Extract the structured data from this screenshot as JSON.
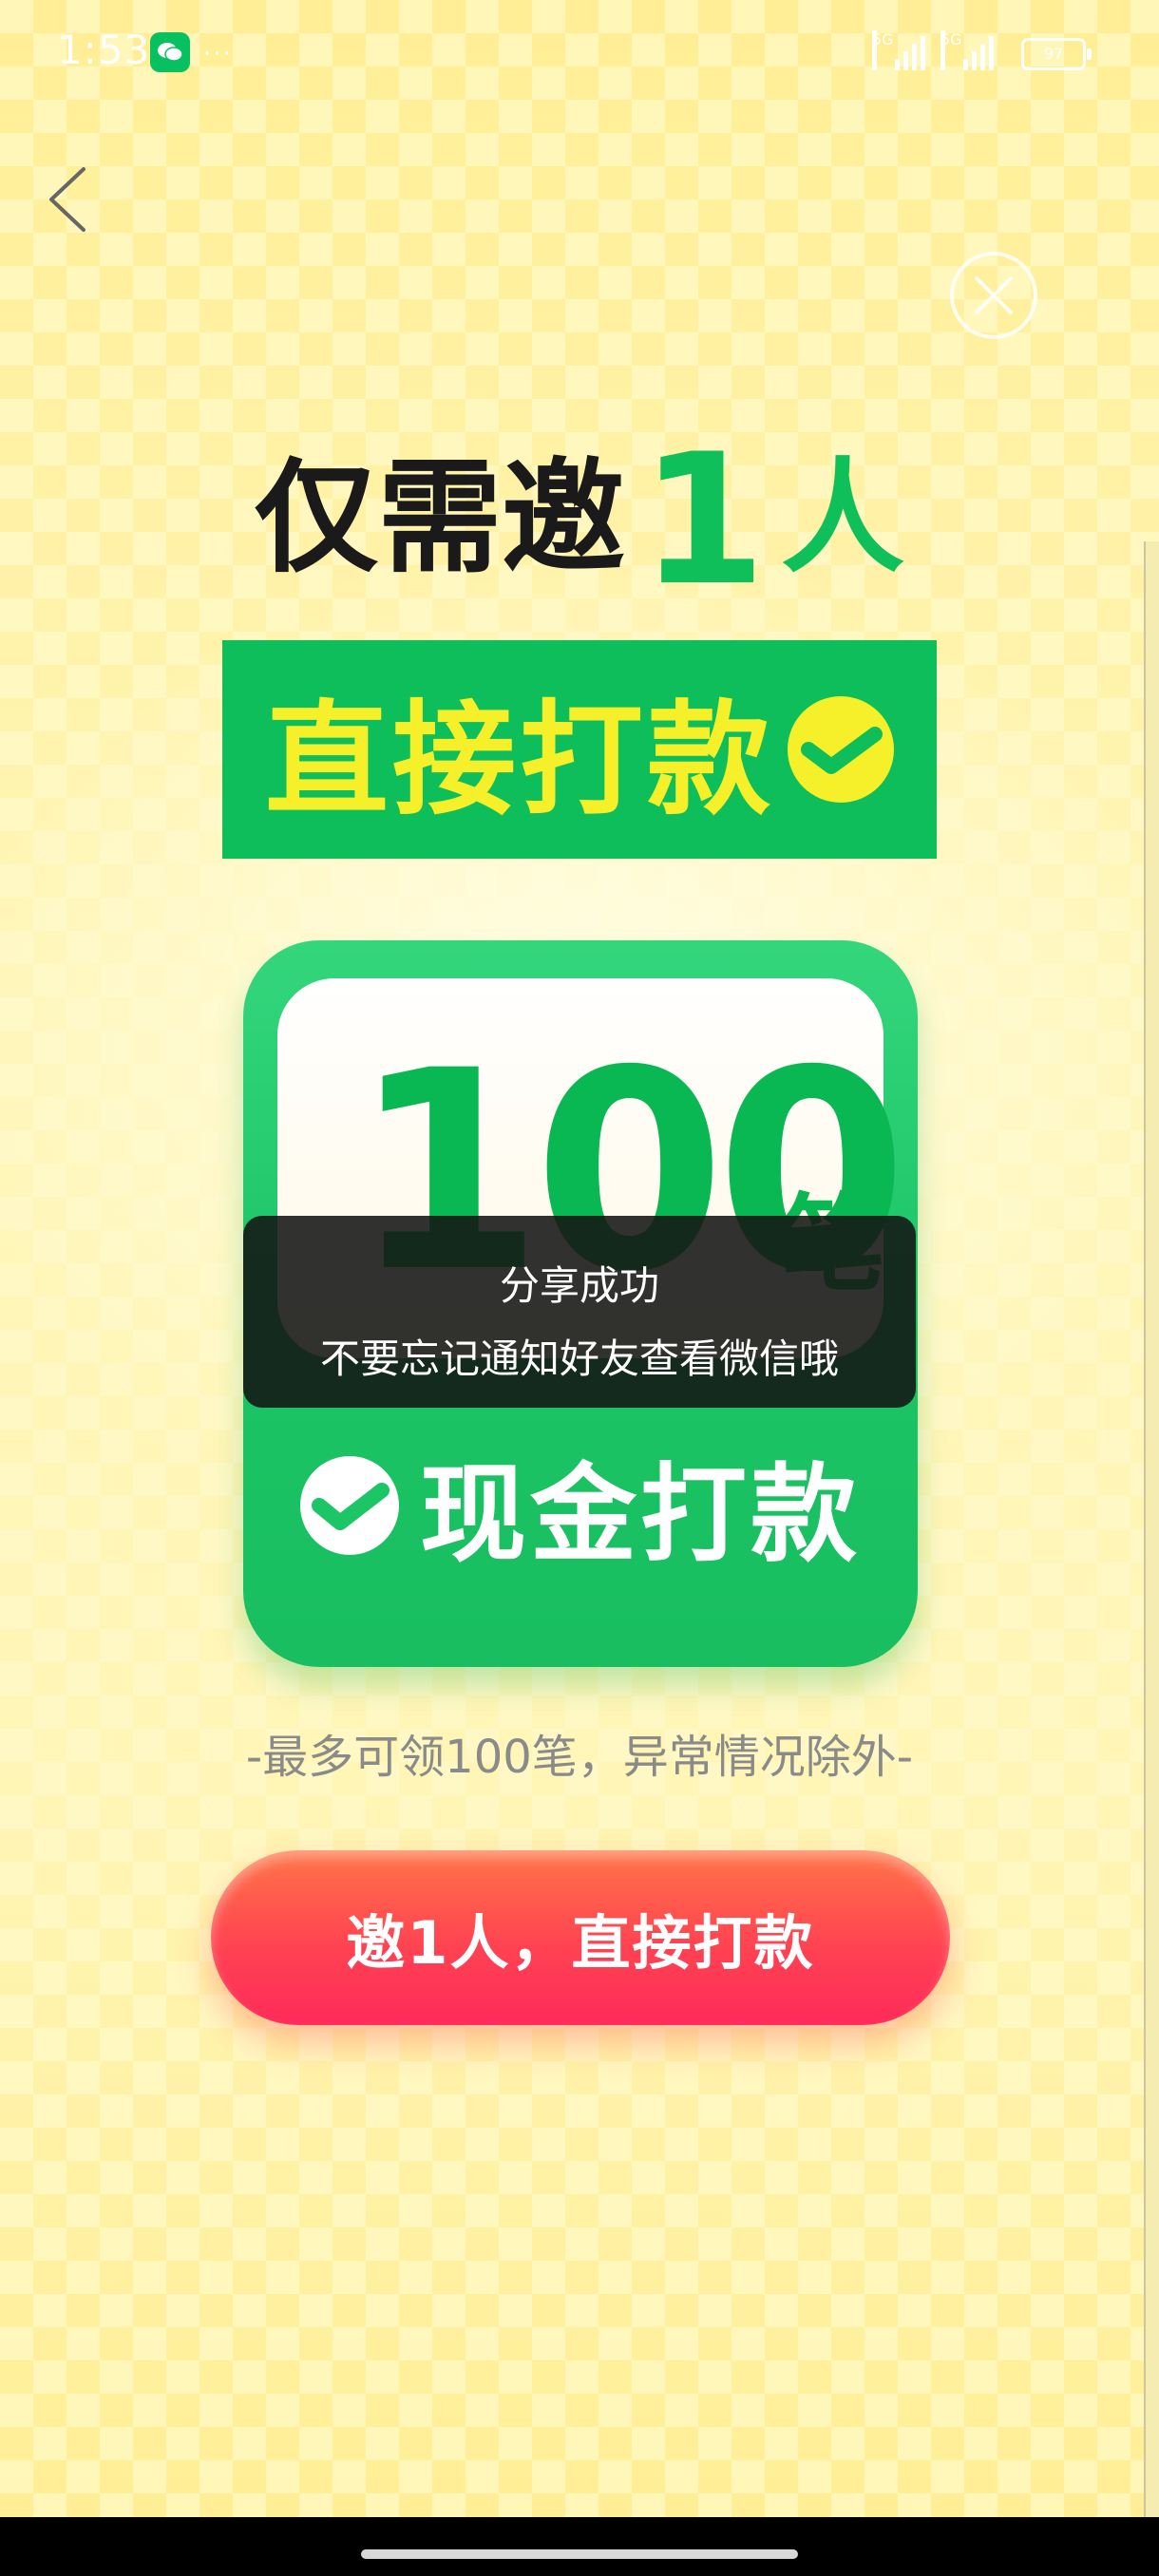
{
  "status_bar": {
    "time": "1:53",
    "notification_dots": "···",
    "sim1_label": "5G",
    "sim2_label": "5G",
    "battery": "97"
  },
  "page": {
    "headline_prefix": "仅需邀",
    "headline_number": "1",
    "headline_suffix": "人",
    "banner_text": "直接打款",
    "card": {
      "amount": "100",
      "unit": "笔",
      "label": "现金打款"
    },
    "note": "-最多可领100笔，异常情况除外-",
    "cta_label": "邀1人，直接打款"
  },
  "toast": {
    "title": "分享成功",
    "message": "不要忘记通知好友查看微信哦"
  },
  "colors": {
    "green": "#0dbe5a",
    "banner_text": "#f6f02a",
    "cta_red": "#ff4352",
    "background": "#fff6b8"
  },
  "icons": {
    "back": "chevron-left-icon",
    "close": "close-circle-icon",
    "wechat_check": "check-circle-icon"
  }
}
